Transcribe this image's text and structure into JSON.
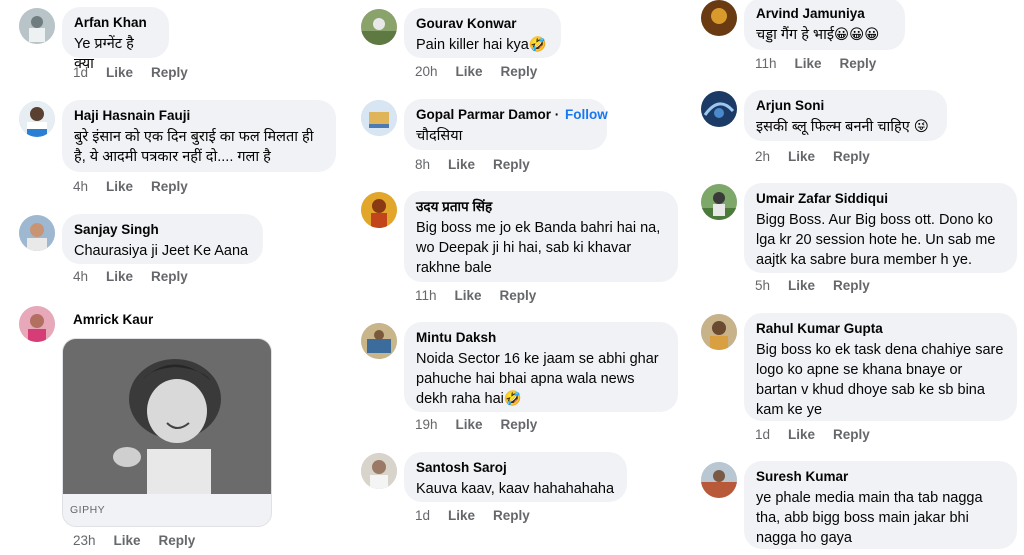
{
  "col1": [
    {
      "name": "Arfan Khan",
      "text": "Ye प्रग्नेंट है क्या",
      "time": "1d",
      "like": "Like",
      "reply": "Reply"
    },
    {
      "name": "Haji Hasnain Fauji",
      "text": "बुरे इंसान को एक दिन बुराई का फल मिलता ही है, ये आदमी पत्रकार नहीं दो.... गला है",
      "time": "4h",
      "like": "Like",
      "reply": "Reply"
    },
    {
      "name": "Sanjay Singh",
      "text": "Chaurasiya ji Jeet Ke Aana",
      "time": "4h",
      "like": "Like",
      "reply": "Reply"
    },
    {
      "name": "Amrick Kaur",
      "gif_label": "GIPHY",
      "time": "23h",
      "like": "Like",
      "reply": "Reply"
    }
  ],
  "col2": [
    {
      "name": "Gourav Konwar",
      "text": "Pain killer hai kya🤣",
      "time": "20h",
      "like": "Like",
      "reply": "Reply"
    },
    {
      "name": "Gopal Parmar Damor",
      "follow": "Follow",
      "text": "चौदसिया",
      "time": "8h",
      "like": "Like",
      "reply": "Reply"
    },
    {
      "name": "उदय प्रताप सिंह",
      "text": "Big boss me jo ek Banda bahri hai na, wo Deepak ji hi hai, sab ki khavar rakhne bale",
      "time": "11h",
      "like": "Like",
      "reply": "Reply"
    },
    {
      "name": "Mintu Daksh",
      "text": "Noida Sector 16 ke jaam se abhi ghar pahuche hai bhai apna wala news dekh raha hai🤣",
      "time": "19h",
      "like": "Like",
      "reply": "Reply"
    },
    {
      "name": "Santosh Saroj",
      "text": "Kauva kaav, kaav hahahahaha",
      "time": "1d",
      "like": "Like",
      "reply": "Reply"
    }
  ],
  "col3": [
    {
      "name": "Arvind Jamuniya",
      "text": "चड्डा गैंग हे भाई😀😀😀",
      "time": "11h",
      "like": "Like",
      "reply": "Reply"
    },
    {
      "name": "Arjun Soni",
      "text": "इसकी ब्लू फिल्म बननी चाहिए 😜",
      "time": "2h",
      "like": "Like",
      "reply": "Reply"
    },
    {
      "name": "Umair Zafar Siddiqui",
      "text": "Bigg Boss. Aur Big boss ott.  Dono ko lga kr 20 session hote he.  Un sab me aajtk ka sabre bura member h ye.",
      "time": "5h",
      "like": "Like",
      "reply": "Reply"
    },
    {
      "name": "Rahul Kumar Gupta",
      "text": "Big boss ko ek task dena chahiye sare logo ko apne se khana bnaye or bartan v khud dhoye sab ke sb bina kam ke ye",
      "time": "1d",
      "like": "Like",
      "reply": "Reply"
    },
    {
      "name": "Suresh Kumar",
      "text": "ye phale media main tha tab nagga tha, abb bigg boss main jakar bhi nagga ho gaya",
      "time": "",
      "like": "",
      "reply": ""
    }
  ],
  "colors": {
    "bubble": "#f0f2f5",
    "meta": "#65676b",
    "link": "#1877f2"
  }
}
